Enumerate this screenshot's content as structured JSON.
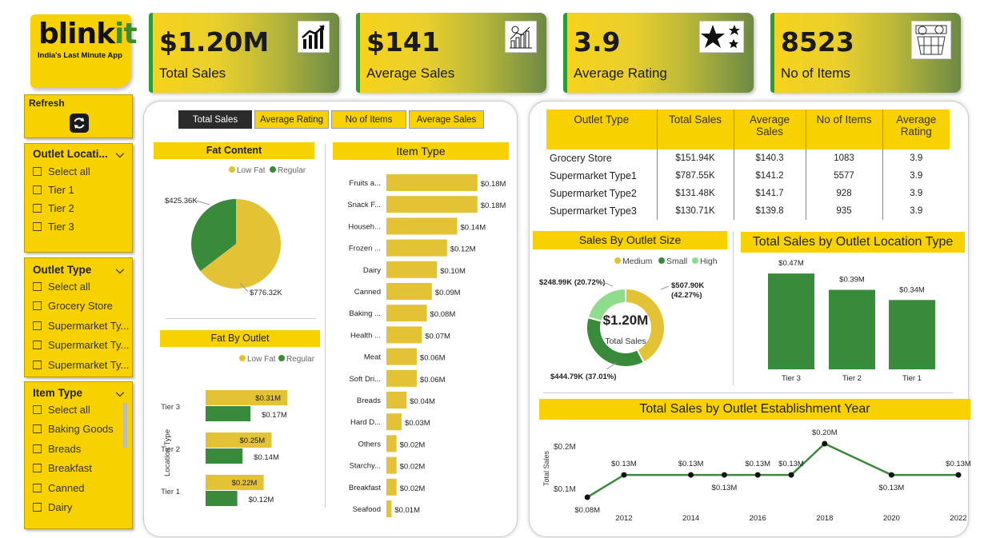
{
  "brand": {
    "name_a": "blink",
    "name_b": "it",
    "tagline": "India's Last Minute App"
  },
  "colors": {
    "yellow": "#f7d200",
    "bar_yellow": "#e3c236",
    "green": "#3a8a3c",
    "light_green": "#8fdc8c"
  },
  "kpis": [
    {
      "value": "$1.20M",
      "label": "Total Sales",
      "icon": "trending-chart-icon"
    },
    {
      "value": "$141",
      "label": "Average Sales",
      "icon": "analytics-icon"
    },
    {
      "value": "3.9",
      "label": "Average Rating",
      "icon": "stars-icon"
    },
    {
      "value": "8523",
      "label": "No of Items",
      "icon": "grocery-basket-icon"
    }
  ],
  "refresh": {
    "label": "Refresh"
  },
  "slicers": {
    "outlet_location": {
      "title": "Outlet Locati...",
      "items": [
        "Select all",
        "Tier 1",
        "Tier 2",
        "Tier 3"
      ]
    },
    "outlet_type": {
      "title": "Outlet Type",
      "items": [
        "Select all",
        "Grocery Store",
        "Supermarket Ty...",
        "Supermarket Ty...",
        "Supermarket Ty..."
      ]
    },
    "item_type": {
      "title": "Item Type",
      "items": [
        "Select all",
        "Baking Goods",
        "Breads",
        "Breakfast",
        "Canned",
        "Dairy"
      ]
    }
  },
  "tabs": [
    "Total Sales",
    "Average Rating",
    "No of Items",
    "Average Sales"
  ],
  "fat_content": {
    "title": "Fat Content",
    "legend": [
      "Low Fat",
      "Regular"
    ]
  },
  "fat_by_outlet": {
    "title": "Fat By Outlet",
    "legend": [
      "Low Fat",
      "Regular"
    ],
    "axis_label": "Location Type"
  },
  "item_type_chart": {
    "title": "Item Type"
  },
  "outlet_table": {
    "headers": [
      "Outlet Type",
      "Total Sales",
      "Average Sales",
      "No of Items",
      "Average Rating"
    ],
    "rows": [
      [
        "Grocery Store",
        "$151.94K",
        "$140.3",
        "1083",
        "3.9"
      ],
      [
        "Supermarket Type1",
        "$787.55K",
        "$141.2",
        "5577",
        "3.9"
      ],
      [
        "Supermarket Type2",
        "$131.48K",
        "$141.7",
        "928",
        "3.9"
      ],
      [
        "Supermarket Type3",
        "$130.71K",
        "$139.8",
        "935",
        "3.9"
      ]
    ]
  },
  "outlet_size": {
    "title": "Sales By Outlet Size",
    "legend": [
      "Medium",
      "Small",
      "High"
    ],
    "center_value": "$1.20M",
    "center_label": "Total Sales"
  },
  "location_type": {
    "title": "Total Sales by Outlet Location Type"
  },
  "establishment": {
    "title": "Total Sales by Outlet Establishment Year",
    "ylabel": "Total Sales",
    "yticks": [
      "$0.2M",
      "$0.1M"
    ]
  },
  "chart_data": [
    {
      "type": "pie",
      "title": "Fat Content",
      "categories": [
        "Low Fat",
        "Regular"
      ],
      "values": [
        776.32,
        425.36
      ],
      "labels": [
        "$776.32K",
        "$425.36K"
      ]
    },
    {
      "type": "bar",
      "title": "Item Type",
      "orientation": "horizontal",
      "categories": [
        "Fruits a...",
        "Snack F...",
        "Househ...",
        "Frozen ...",
        "Dairy",
        "Canned",
        "Baking ...",
        "Health ...",
        "Meat",
        "Soft Dri...",
        "Breads",
        "Hard D...",
        "Others",
        "Starchy...",
        "Breakfast",
        "Seafood"
      ],
      "values": [
        0.18,
        0.18,
        0.14,
        0.12,
        0.1,
        0.09,
        0.08,
        0.07,
        0.06,
        0.06,
        0.04,
        0.03,
        0.02,
        0.02,
        0.02,
        0.01
      ],
      "labels": [
        "$0.18M",
        "$0.18M",
        "$0.14M",
        "$0.12M",
        "$0.10M",
        "$0.09M",
        "$0.08M",
        "$0.07M",
        "$0.06M",
        "$0.06M",
        "$0.04M",
        "$0.03M",
        "$0.02M",
        "$0.02M",
        "$0.02M",
        "$0.01M"
      ]
    },
    {
      "type": "bar",
      "title": "Fat By Outlet",
      "orientation": "horizontal",
      "categories": [
        "Tier 3",
        "Tier 2",
        "Tier 1"
      ],
      "ylabel": "Location Type",
      "series": [
        {
          "name": "Low Fat",
          "values": [
            0.31,
            0.25,
            0.22
          ],
          "labels": [
            "$0.31M",
            "$0.25M",
            "$0.22M"
          ]
        },
        {
          "name": "Regular",
          "values": [
            0.17,
            0.14,
            0.12
          ],
          "labels": [
            "$0.17M",
            "$0.14M",
            "$0.12M"
          ]
        }
      ]
    },
    {
      "type": "pie",
      "title": "Sales By Outlet Size",
      "donut": true,
      "categories": [
        "Medium",
        "Small",
        "High"
      ],
      "values": [
        507.9,
        444.79,
        248.99
      ],
      "labels": [
        "$507.90K (42.27%)",
        "$444.79K (37.01%)",
        "$248.99K (20.72%)"
      ]
    },
    {
      "type": "bar",
      "title": "Total Sales by Outlet Location Type",
      "categories": [
        "Tier 3",
        "Tier 2",
        "Tier 1"
      ],
      "values": [
        0.47,
        0.39,
        0.34
      ],
      "labels": [
        "$0.47M",
        "$0.39M",
        "$0.34M"
      ]
    },
    {
      "type": "line",
      "title": "Total Sales by Outlet Establishment Year",
      "ylabel": "Total Sales",
      "x": [
        2011,
        2012,
        2014,
        2015,
        2016,
        2017,
        2018,
        2020,
        2022
      ],
      "values": [
        0.08,
        0.13,
        0.13,
        0.13,
        0.13,
        0.13,
        0.2,
        0.13,
        0.13
      ],
      "labels": [
        "$0.08M",
        "$0.13M",
        "$0.13M",
        "$0.13M",
        "$0.13M",
        "$0.13M",
        "$0.20M",
        "$0.13M",
        "$0.13M"
      ],
      "xticks": [
        "2012",
        "2014",
        "2016",
        "2018",
        "2020",
        "2022"
      ]
    }
  ]
}
